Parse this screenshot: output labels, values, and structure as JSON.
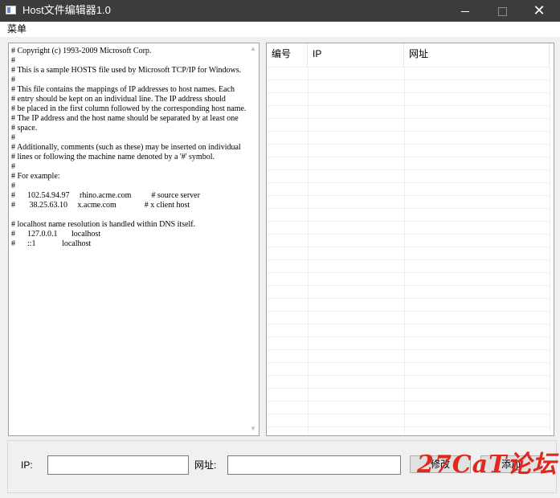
{
  "window": {
    "title": "Host文件编辑器1.0",
    "icon": "app-window-icon",
    "controls": [
      "minimize-icon",
      "maximize-icon",
      "close-icon"
    ],
    "close_glyph": "✕"
  },
  "menu": {
    "items": [
      "菜单"
    ]
  },
  "hosts_text": "# Copyright (c) 1993-2009 Microsoft Corp.\n#\n# This is a sample HOSTS file used by Microsoft TCP/IP for Windows.\n#\n# This file contains the mappings of IP addresses to host names. Each\n# entry should be kept on an individual line. The IP address should\n# be placed in the first column followed by the corresponding host name.\n# The IP address and the host name should be separated by at least one\n# space.\n#\n# Additionally, comments (such as these) may be inserted on individual\n# lines or following the machine name denoted by a '#' symbol.\n#\n# For example:\n#\n#      102.54.94.97     rhino.acme.com          # source server\n#       38.25.63.10     x.acme.com              # x client host\n\n# localhost name resolution is handled within DNS itself.\n#\t127.0.0.1       localhost\n#\t::1             localhost",
  "table": {
    "columns": [
      "编号",
      "IP",
      "网址"
    ],
    "rows": []
  },
  "form": {
    "ip_label": "IP:",
    "ip_value": "",
    "url_label": "网址:",
    "url_value": "",
    "edit_button": "修改",
    "add_button": "添加"
  },
  "watermark": "27CaT论坛",
  "colors": {
    "titlebar": "#3c3c3c",
    "watermark": "#e0281f"
  }
}
